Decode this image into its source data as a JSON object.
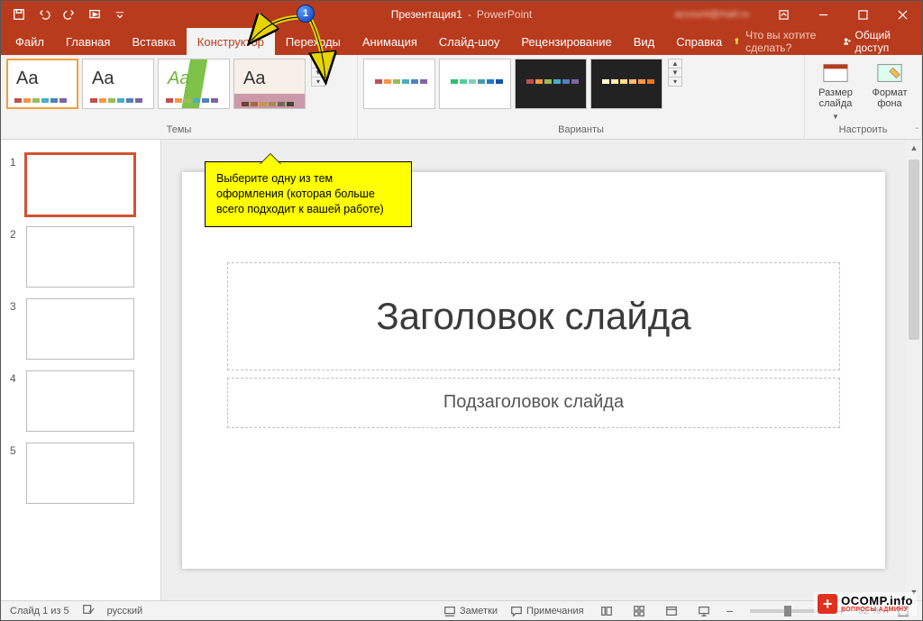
{
  "title": {
    "doc": "Презентация1",
    "app": "PowerPoint",
    "account": "account@mail.ru"
  },
  "tabs": [
    "Файл",
    "Главная",
    "Вставка",
    "Конструктор",
    "Переходы",
    "Анимация",
    "Слайд-шоу",
    "Рецензирование",
    "Вид",
    "Справка"
  ],
  "active_tab_index": 3,
  "tellme": "Что вы хотите сделать?",
  "share": "Общий доступ",
  "ribbon": {
    "themes_label": "Темы",
    "variants_label": "Варианты",
    "configure_label": "Настроить",
    "slide_size": "Размер слайда",
    "format_bg": "Формат фона"
  },
  "callout_number": "1",
  "callout_text": "Выберите одну из тем оформления (которая больше всего подходит к вашей работе)",
  "slide": {
    "title_ph": "Заголовок слайда",
    "subtitle_ph": "Подзаголовок слайда"
  },
  "thumbs": [
    1,
    2,
    3,
    4,
    5
  ],
  "status": {
    "slide_of": "Слайд 1 из 5",
    "lang": "русский",
    "notes": "Заметки",
    "comments": "Примечания",
    "zoom": "62 %"
  },
  "watermark": {
    "top": "OCOMP.info",
    "bottom": "ВОПРОСЫ АДМИНУ"
  }
}
